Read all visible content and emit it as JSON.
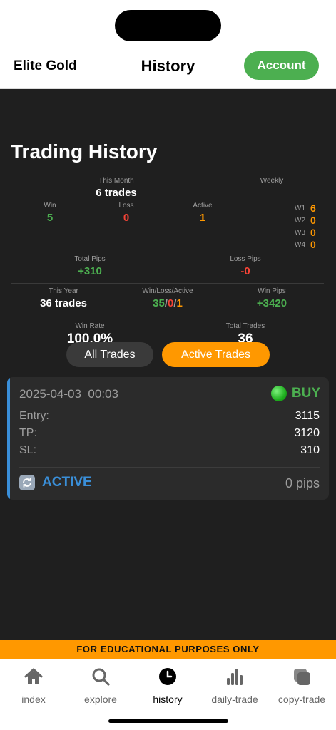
{
  "header": {
    "brand": "Elite Gold",
    "title": "History",
    "account_label": "Account"
  },
  "page": {
    "title": "Trading History"
  },
  "this_month": {
    "label": "This Month",
    "value": "6 trades",
    "win_label": "Win",
    "win": "5",
    "loss_label": "Loss",
    "loss": "0",
    "active_label": "Active",
    "active": "1"
  },
  "weekly": {
    "label": "Weekly",
    "weeks": [
      {
        "label": "W1",
        "value": "6"
      },
      {
        "label": "W2",
        "value": "0"
      },
      {
        "label": "W3",
        "value": "0"
      },
      {
        "label": "W4",
        "value": "0"
      }
    ]
  },
  "pips": {
    "total_label": "Total Pips",
    "total": "+310",
    "loss_label": "Loss Pips",
    "loss": "-0"
  },
  "year": {
    "label": "This Year",
    "value": "36 trades",
    "wla_label": "Win/Loss/Active",
    "win": "35",
    "sep": "/",
    "loss": "0",
    "active": "1",
    "win_pips_label": "Win Pips",
    "win_pips": "+3420"
  },
  "rates": {
    "win_rate_label": "Win Rate",
    "win_rate": "100.0%",
    "total_trades_label": "Total Trades",
    "total_trades": "36"
  },
  "filters": {
    "all": "All Trades",
    "active": "Active Trades"
  },
  "trade": {
    "date": "2025-04-03",
    "time": "00:03",
    "side": "BUY",
    "entry_label": "Entry:",
    "entry": "3115",
    "tp_label": "TP:",
    "tp": "3120",
    "sl_label": "SL:",
    "sl": "310",
    "status": "ACTIVE",
    "pips": "0 pips"
  },
  "disclaimer": "FOR EDUCATIONAL PURPOSES ONLY",
  "tabs": [
    {
      "label": "index",
      "icon": "home-icon"
    },
    {
      "label": "explore",
      "icon": "search-icon"
    },
    {
      "label": "history",
      "icon": "clock-icon"
    },
    {
      "label": "daily-trade",
      "icon": "bar-chart-icon"
    },
    {
      "label": "copy-trade",
      "icon": "copy-icon"
    }
  ],
  "colors": {
    "accent_green": "#4caf50",
    "accent_orange": "#ff9800",
    "loss_red": "#f44336",
    "active_blue": "#3a8fd9",
    "background": "#1f1f1f"
  }
}
